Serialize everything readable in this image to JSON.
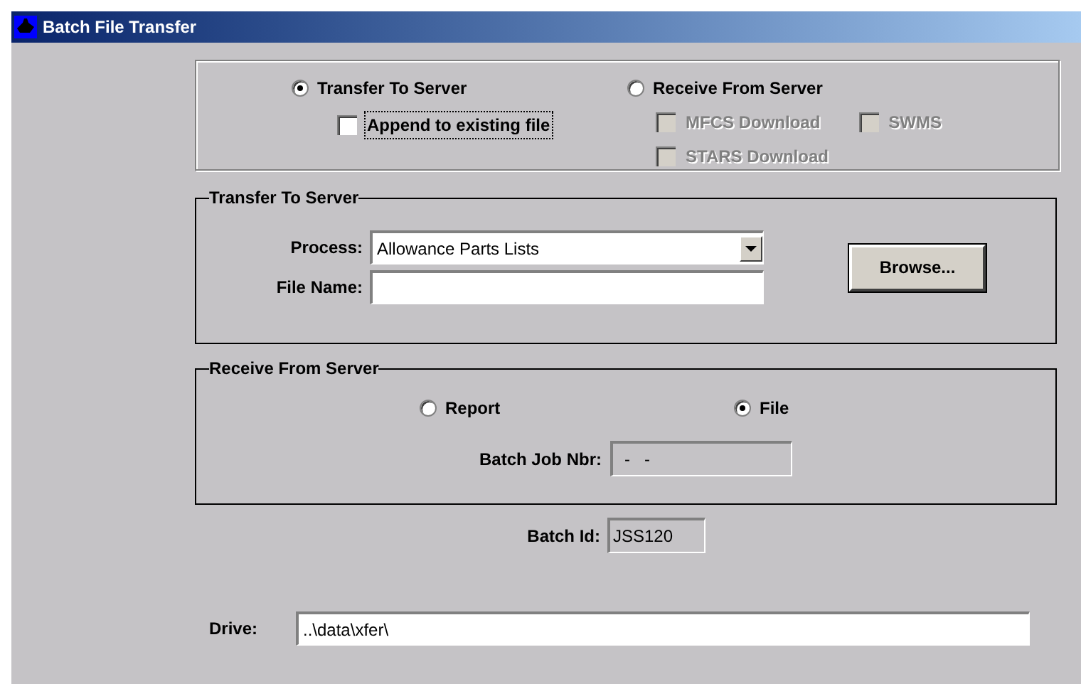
{
  "window": {
    "title": "Batch File Transfer"
  },
  "mode": [
    {
      "label": "Transfer To Server",
      "selected": true
    },
    {
      "label": "Receive From Server",
      "selected": false
    }
  ],
  "append": {
    "label": "Append to existing file",
    "checked": false,
    "focused": true
  },
  "downloads": [
    {
      "label": "MFCS Download",
      "checked": false,
      "disabled": true
    },
    {
      "label": "SWMS",
      "checked": false,
      "disabled": true
    },
    {
      "label": "STARS Download",
      "checked": false,
      "disabled": true
    }
  ],
  "transfer_group": {
    "title": "Transfer To Server",
    "process_label": "Process:",
    "process_value": "Allowance Parts Lists",
    "file_name_label": "File Name:",
    "browse": "Browse..."
  },
  "receive_group": {
    "title": "Receive From Server",
    "options": [
      {
        "label": "Report",
        "selected": false
      },
      {
        "label": "File",
        "selected": true
      }
    ],
    "batch_job_label": "Batch Job Nbr:",
    "batch_job_value": "-   -"
  },
  "batch_id": {
    "label": "Batch Id:",
    "value": "JSS120"
  },
  "drive": {
    "label": "Drive:",
    "value": "..\\data\\xfer\\"
  }
}
